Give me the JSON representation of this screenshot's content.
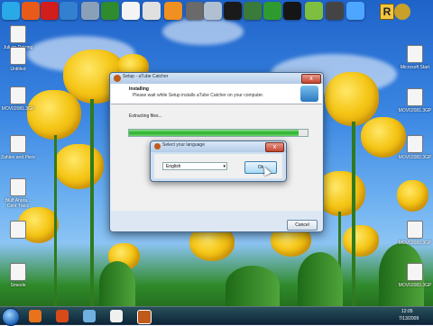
{
  "setup_window": {
    "title": "Setup - aTube Catcher",
    "header_title": "Installing",
    "header_subtitle": "Please wait while Setup installs aTube Catcher on your computer.",
    "status": "Extracting files...",
    "progress_fraction": 0.95,
    "cancel_label": "Cancel",
    "close_glyph": "x"
  },
  "language_dialog": {
    "title": "Select your language",
    "selected_language": "English",
    "dropdown_glyph": "▾",
    "ok_label": "Ok",
    "close_glyph": "x"
  },
  "desktop_icons": [
    {
      "label": "Juli on Raizing"
    },
    {
      "label": "Untitled"
    },
    {
      "label": "MOV02081.3GP"
    },
    {
      "label": "Zahlen and Piers"
    },
    {
      "label": "Bluff Ahora... Cent Tracc"
    },
    {
      "label": "Smeole"
    },
    {
      "label": "Microsoft Start"
    },
    {
      "label": "MOV02081.3GP"
    },
    {
      "label": "MOV02082.3GP"
    },
    {
      "label": "MOV02082.3GP"
    },
    {
      "label": "MOV02083.3GP"
    }
  ],
  "dock_icons": [
    "skype-icon",
    "firefox-icon",
    "pdf-icon",
    "globe-icon",
    "tool-icon",
    "excel-icon",
    "acrobat-icon",
    "webcam-icon",
    "ie-icon",
    "app-icon",
    "media-icon",
    "utorrent-icon",
    "shirt-icon",
    "folder-icon",
    "game-icon",
    "music-icon"
  ],
  "tray": {
    "time": "12:05",
    "date": "7/13/2009"
  }
}
